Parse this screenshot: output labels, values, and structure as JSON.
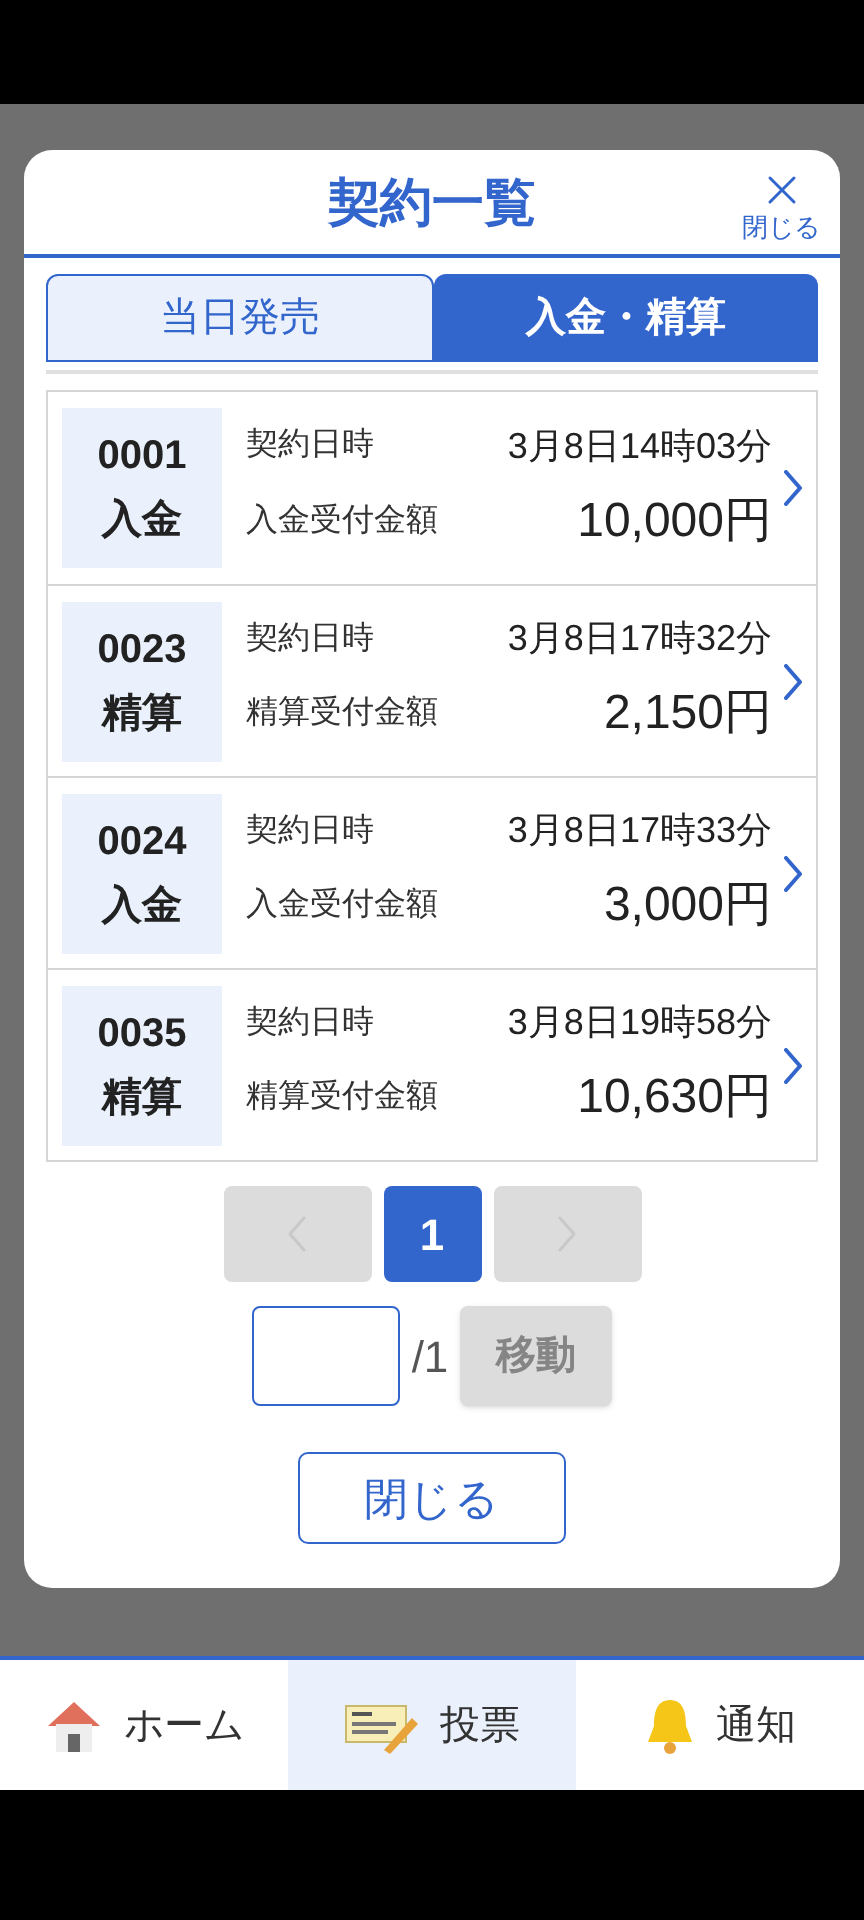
{
  "dialog": {
    "title": "契約一覧",
    "close_label": "閉じる",
    "tabs": [
      {
        "label": "当日発売",
        "selected": false
      },
      {
        "label": "入金・精算",
        "selected": true
      }
    ],
    "contracts": [
      {
        "number": "0001",
        "type": "入金",
        "date_label": "契約日時",
        "date": "3月8日14時03分",
        "amount_label": "入金受付金額",
        "amount": "10,000円"
      },
      {
        "number": "0023",
        "type": "精算",
        "date_label": "契約日時",
        "date": "3月8日17時32分",
        "amount_label": "精算受付金額",
        "amount": "2,150円"
      },
      {
        "number": "0024",
        "type": "入金",
        "date_label": "契約日時",
        "date": "3月8日17時33分",
        "amount_label": "入金受付金額",
        "amount": "3,000円"
      },
      {
        "number": "0035",
        "type": "精算",
        "date_label": "契約日時",
        "date": "3月8日19時58分",
        "amount_label": "精算受付金額",
        "amount": "10,630円"
      }
    ],
    "pagination": {
      "prev_disabled": true,
      "pages": [
        {
          "label": "1",
          "selected": true
        }
      ],
      "next_disabled": true,
      "total": "/1",
      "go_label": "移動",
      "go_disabled": true
    },
    "close_button": "閉じる"
  },
  "bottom_nav": [
    {
      "kind": "home",
      "label": "ホーム",
      "selected": false
    },
    {
      "kind": "vote",
      "label": "投票",
      "selected": true
    },
    {
      "kind": "notify",
      "label": "通知",
      "selected": false
    }
  ]
}
